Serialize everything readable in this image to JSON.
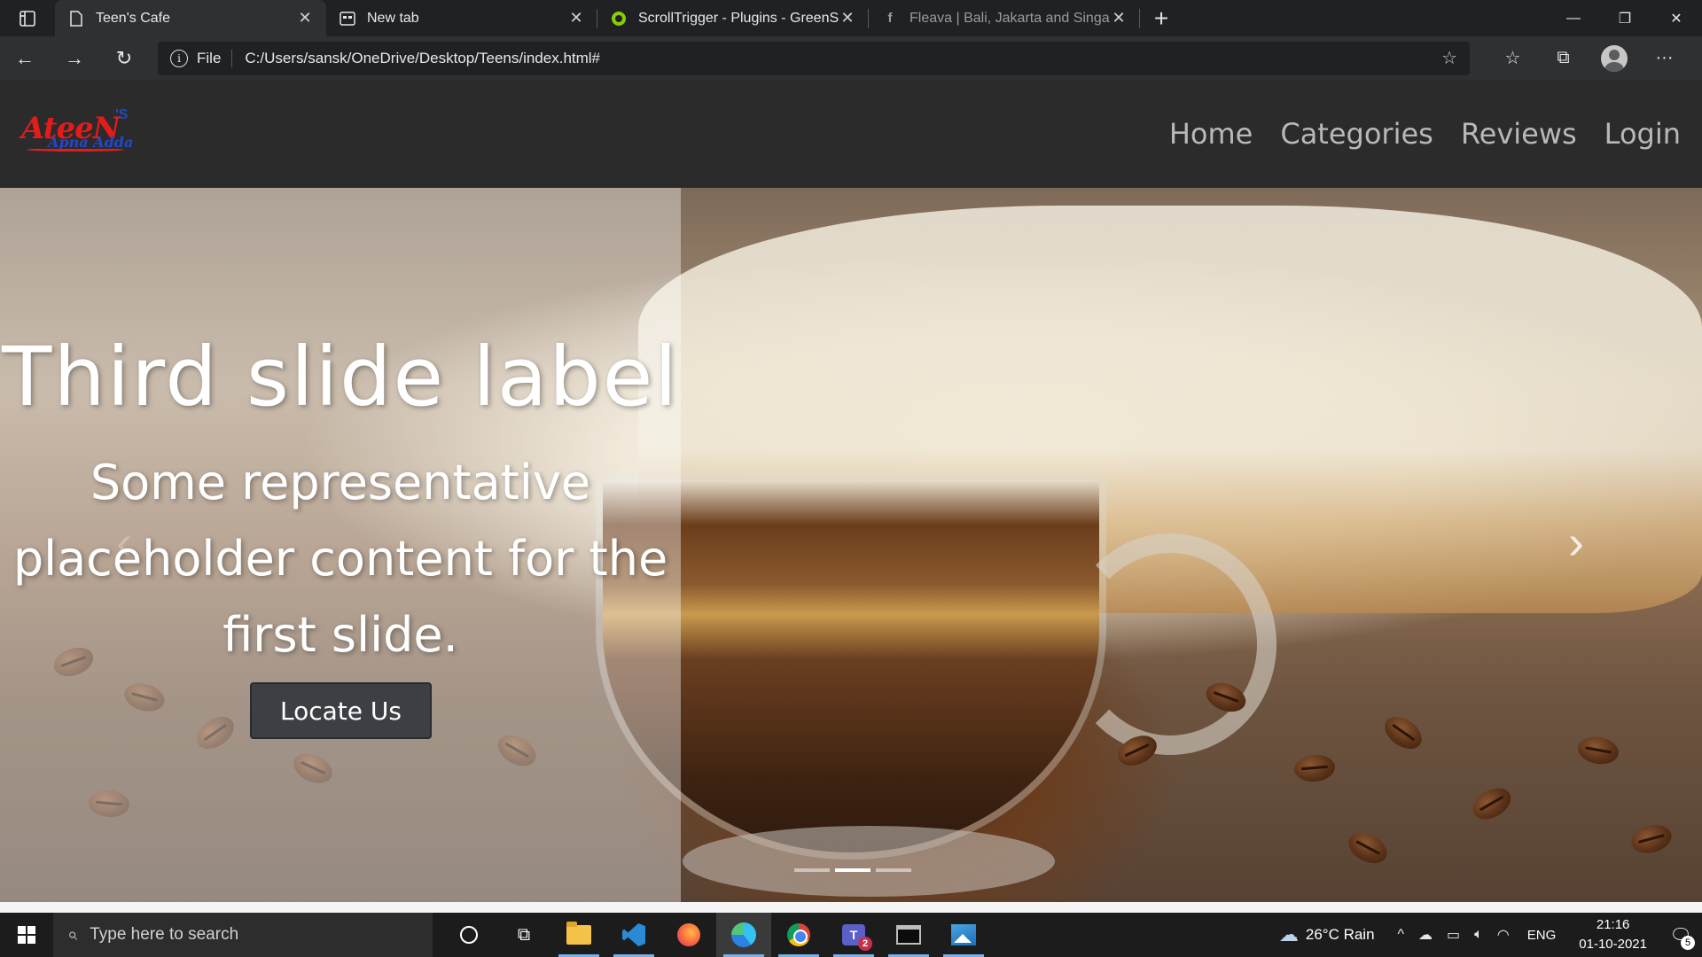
{
  "browser": {
    "tabs": [
      {
        "title": "Teen's Cafe",
        "icon": "page-icon",
        "active": true
      },
      {
        "title": "New tab",
        "icon": "newtab-icon",
        "active": false
      },
      {
        "title": "ScrollTrigger - Plugins - GreenSock",
        "icon": "greensock-icon",
        "active": false
      },
      {
        "title": "Fleava | Bali, Jakarta and Singapore",
        "icon": "facebook-icon",
        "active": false
      }
    ],
    "address": {
      "info_label": "File",
      "url": "C:/Users/sansk/OneDrive/Desktop/Teens/index.html#"
    }
  },
  "site": {
    "logo": {
      "main": "AteeN",
      "suffix": "'S",
      "sub": "Apna Adda"
    },
    "nav": [
      "Home",
      "Categories",
      "Reviews",
      "Login"
    ]
  },
  "hero": {
    "title": "Third slide label",
    "text": "Some representative placeholder content for the first slide.",
    "button": "Locate Us",
    "slides": 3,
    "active_slide": 2
  },
  "taskbar": {
    "search_placeholder": "Type here to search",
    "apps": [
      "cortana-icon",
      "task-view-icon",
      "file-explorer-icon",
      "vscode-icon",
      "firefox-icon",
      "edge-icon",
      "chrome-icon",
      "teams-icon",
      "terminal-icon",
      "photos-icon"
    ],
    "teams_badge": "2",
    "weather": "26°C  Rain",
    "language": "ENG",
    "time": "21:16",
    "date": "01-10-2021",
    "notifications": "5"
  }
}
